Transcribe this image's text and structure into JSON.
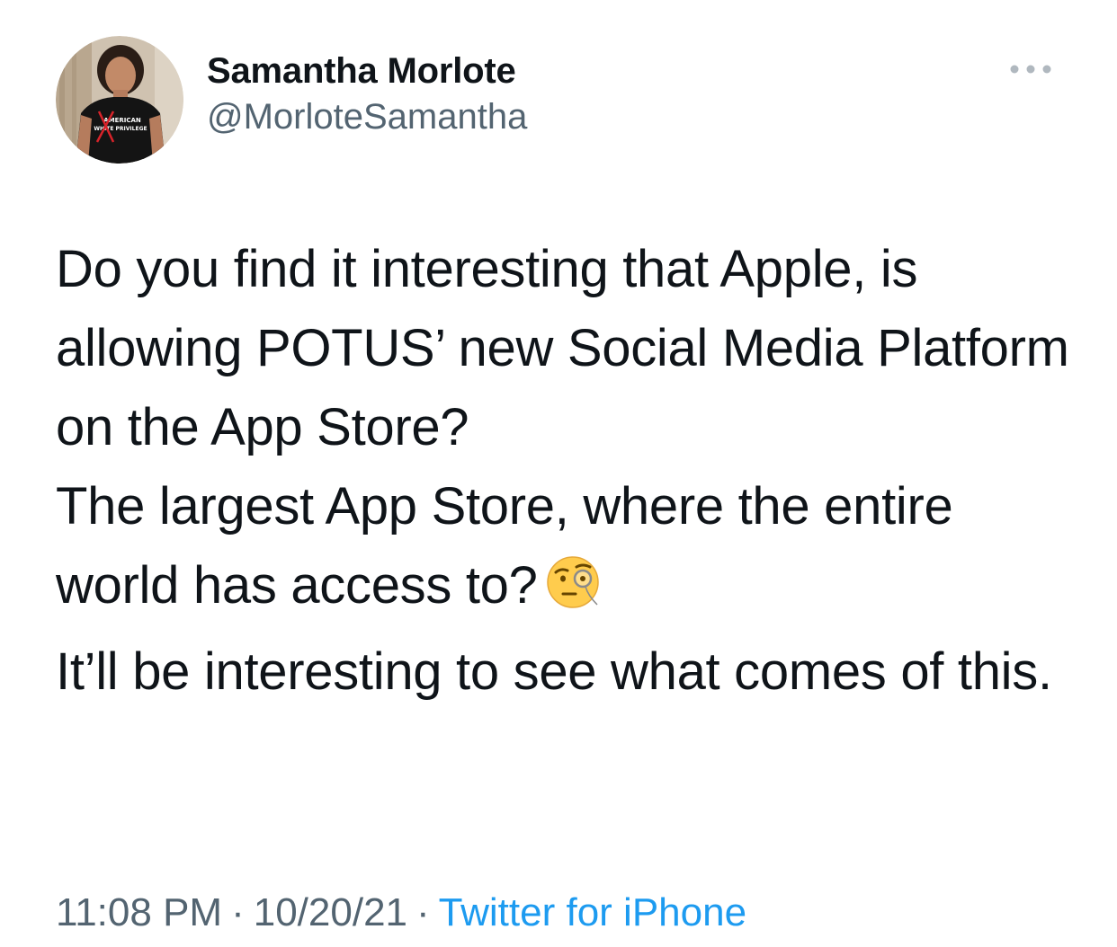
{
  "author": {
    "display_name": "Samantha Morlote",
    "handle": "@MorloteSamantha",
    "avatar_shirt_text": [
      "AMERICAN",
      "WHITE PRIVILEGE"
    ]
  },
  "more_icon": "more-horizontal-icon",
  "tweet": {
    "paragraphs": [
      "Do you find it interesting that Apple, is allowing POTUS’ new Social Media Platform on the App Store?",
      "The largest App Store, where the entire world has access to?",
      "It’ll be interesting to see what comes of this."
    ],
    "emoji": "face-with-monocle-emoji"
  },
  "meta": {
    "time": "11:08 PM",
    "separator": "·",
    "date": "10/20/21",
    "source": "Twitter for iPhone"
  },
  "colors": {
    "text": "#0f1419",
    "secondary": "#536471",
    "link": "#1d9bf0",
    "background": "#ffffff"
  }
}
